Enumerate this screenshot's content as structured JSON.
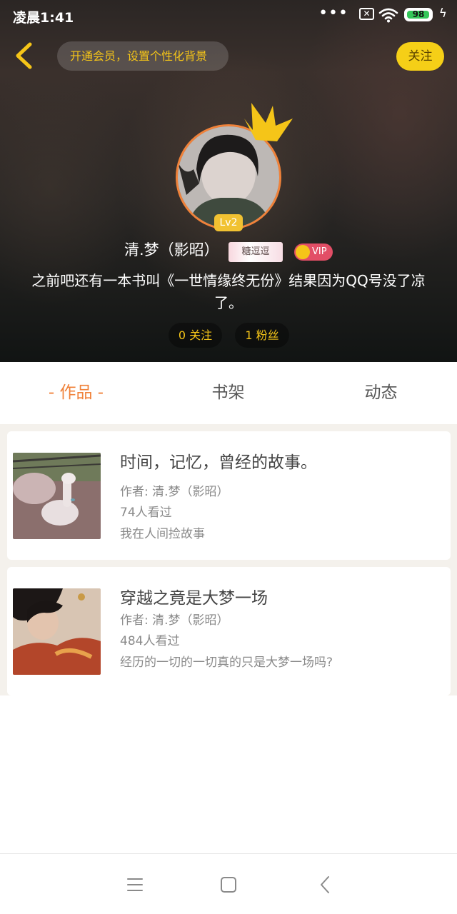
{
  "status_bar": {
    "time": "凌晨1:41",
    "dots": "•••",
    "sim_icon": "sim-x-icon",
    "wifi_icon": "wifi-icon",
    "battery": "98",
    "battery_level": 0.98,
    "charging_icon": "bolt-icon"
  },
  "header": {
    "back_icon": "chevron-left-icon",
    "vip_banner": "开通会员，设置个性化背景",
    "follow_label": "关注"
  },
  "profile": {
    "level": "Lv2",
    "name": "清.梦（影昭）",
    "medal": "糖逗逗",
    "vip": "VIP",
    "bio": "之前吧还有一本书叫《一世情缘终无份》结果因为QQ号没了凉了。",
    "following": "0 关注",
    "followers": "1 粉丝"
  },
  "tabs": [
    {
      "label": "- 作品 -",
      "active": true
    },
    {
      "label": "书架",
      "active": false
    },
    {
      "label": "动态",
      "active": false
    }
  ],
  "works": [
    {
      "title": "时间，记忆，曾经的故事。",
      "author": "作者: 清.梦（影昭）",
      "views": "74人看过",
      "intro": "我在人间捡故事"
    },
    {
      "title": "穿越之竟是大梦一场",
      "author": "作者: 清.梦（影昭）",
      "views": "484人看过",
      "intro": "经历的一切的一切真的只是大梦一场吗?"
    }
  ],
  "nav": {
    "menu_icon": "menu-icon",
    "home_icon": "home-square-icon",
    "back_icon": "back-triangle-icon"
  },
  "colors": {
    "accent": "#f0823a",
    "gold": "#f5c518",
    "follow_bg": "#f5cf17",
    "vip_pink": "#e24e66"
  }
}
